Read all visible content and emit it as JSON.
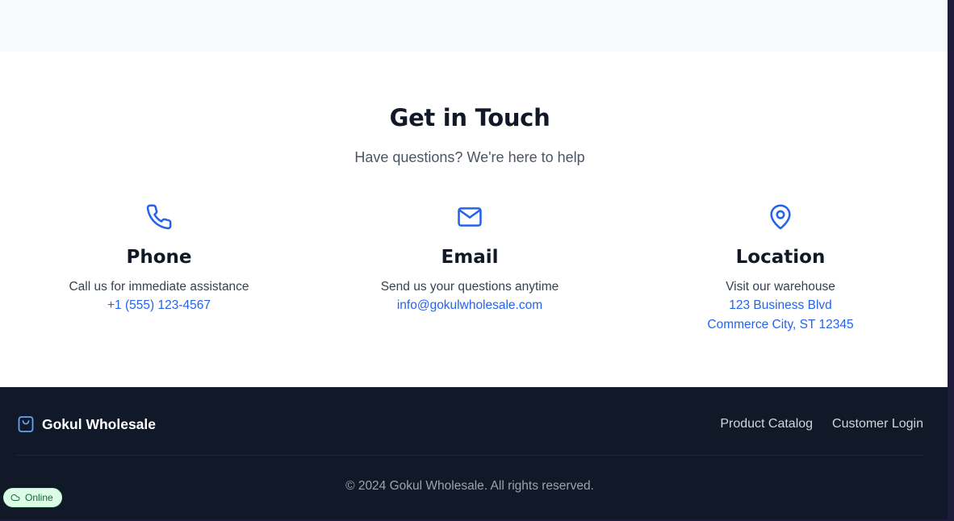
{
  "contact": {
    "title": "Get in Touch",
    "subtitle": "Have questions? We're here to help",
    "cards": [
      {
        "icon": "phone-icon",
        "title": "Phone",
        "description": "Call us for immediate assistance",
        "link": "+1 (555) 123-4567"
      },
      {
        "icon": "mail-icon",
        "title": "Email",
        "description": "Send us your questions anytime",
        "link": "info@gokulwholesale.com"
      },
      {
        "icon": "map-pin-icon",
        "title": "Location",
        "description": "Visit our warehouse",
        "address_lines": [
          "123 Business Blvd",
          "Commerce City, ST 12345"
        ]
      }
    ]
  },
  "footer": {
    "brand_icon": "shopping-bag-icon",
    "brand_name": "Gokul Wholesale",
    "nav": [
      "Product Catalog",
      "Customer Login"
    ],
    "copyright": "© 2024 Gokul Wholesale. All rights reserved."
  },
  "status": {
    "icon": "cloud-icon",
    "label": "Online"
  },
  "colors": {
    "accent": "#2563eb",
    "footer_bg": "#111827",
    "heading": "#111827",
    "status_bg": "#dcfce7",
    "status_text": "#166534"
  }
}
